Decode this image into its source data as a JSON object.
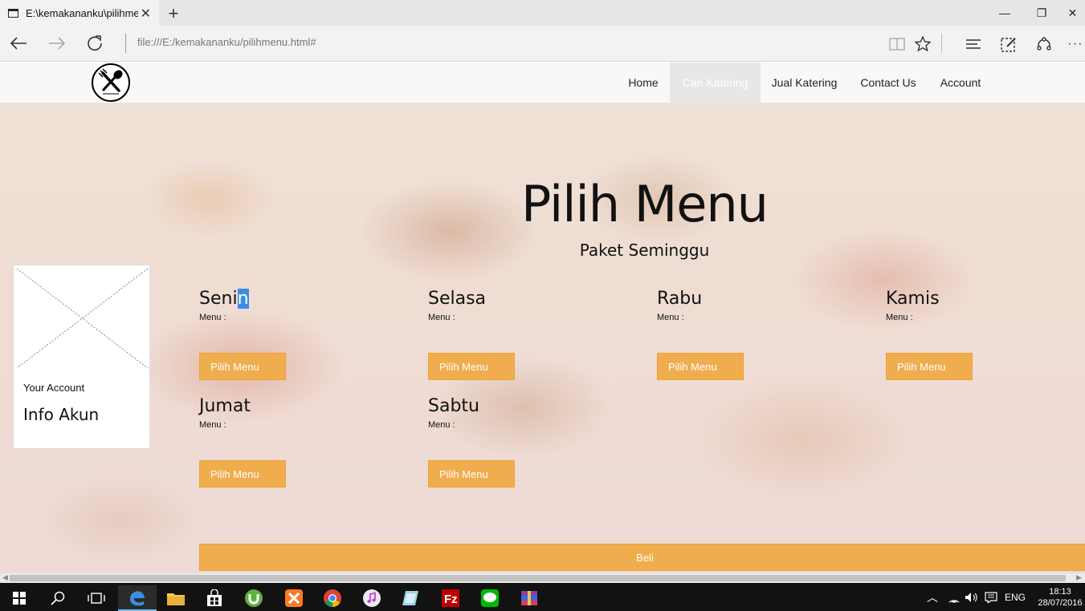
{
  "browser": {
    "tab_title": "E:\\kemakananku\\pilihmenu.html",
    "address": "file:///E:/kemakananku/pilihmenu.html#"
  },
  "site": {
    "nav": [
      {
        "label": "Home"
      },
      {
        "label": "Cari Katering",
        "active": true
      },
      {
        "label": "Jual Katering"
      },
      {
        "label": "Contact Us"
      },
      {
        "label": "Account"
      }
    ],
    "title": "Pilih Menu",
    "subtitle": "Paket Seminggu",
    "account_card": {
      "small": "Your Account",
      "big": "Info Akun"
    },
    "days": [
      {
        "name": "Senin",
        "menu_label": "Menu :",
        "button": "Pilih Menu"
      },
      {
        "name": "Selasa",
        "menu_label": "Menu :",
        "button": "Pilih Menu"
      },
      {
        "name": "Rabu",
        "menu_label": "Menu :",
        "button": "Pilih Menu"
      },
      {
        "name": "Kamis",
        "menu_label": "Menu :",
        "button": "Pilih Menu"
      },
      {
        "name": "Jumat",
        "menu_label": "Menu :",
        "button": "Pilih Menu"
      },
      {
        "name": "Sabtu",
        "menu_label": "Menu :",
        "button": "Pilih Menu"
      }
    ],
    "buy_button": "Beli",
    "accent": "#f0ad4e"
  },
  "taskbar": {
    "language": "ENG",
    "time": "18:13",
    "date": "28/07/2016"
  }
}
